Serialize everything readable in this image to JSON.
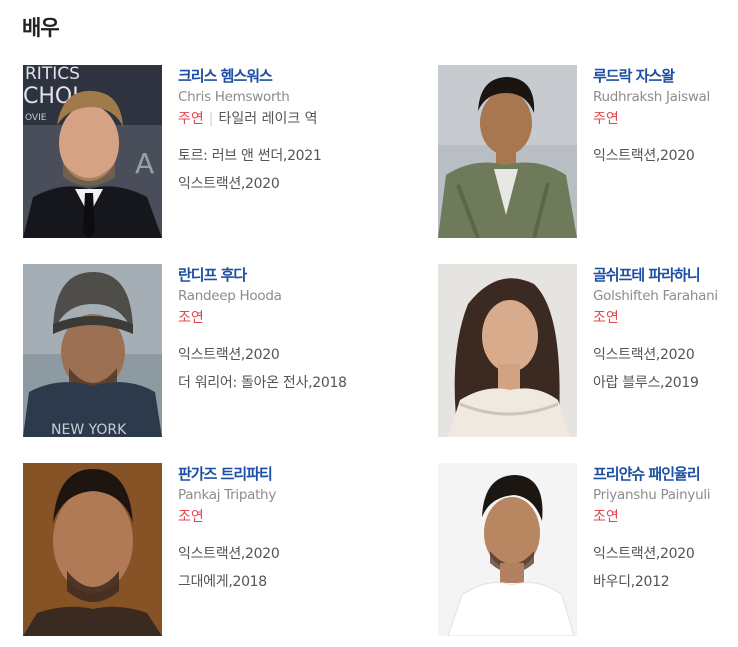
{
  "section": {
    "title": "배우"
  },
  "actors": [
    {
      "name_ko": "크리스 헴스워스",
      "name_en": "Chris Hemsworth",
      "role": "주연",
      "character": "타일러 레이크 역",
      "works": [
        "토르: 러브 앤 썬더,2021",
        "익스트랙션,2020"
      ]
    },
    {
      "name_ko": "루드락 자스왈",
      "name_en": "Rudhraksh Jaiswal",
      "role": "주연",
      "character": "",
      "works": [
        "익스트랙션,2020"
      ]
    },
    {
      "name_ko": "란디프 후다",
      "name_en": "Randeep Hooda",
      "role": "조연",
      "character": "",
      "works": [
        "익스트랙션,2020",
        "더 워리어: 돌아온 전사,2018"
      ]
    },
    {
      "name_ko": "골쉬프테 파라하니",
      "name_en": "Golshifteh Farahani",
      "role": "조연",
      "character": "",
      "works": [
        "익스트랙션,2020",
        "아랍 블루스,2019"
      ]
    },
    {
      "name_ko": "판가즈 트리파티",
      "name_en": "Pankaj Tripathy",
      "role": "조연",
      "character": "",
      "works": [
        "익스트랙션,2020",
        "그대에게,2018"
      ]
    },
    {
      "name_ko": "프리얀슈 패인율리",
      "name_en": "Priyanshu Painyuli",
      "role": "조연",
      "character": "",
      "works": [
        "익스트랙션,2020",
        "바우디,2012"
      ]
    }
  ],
  "photo_art": {
    "backdrop_text_1": "RITICS",
    "backdrop_text_2": "CHOI",
    "backdrop_text_3": "OVIE",
    "backdrop_text_4": "A",
    "hoodie_text": "NEW YORK"
  },
  "colors": {
    "name_link": "#1d4fa3",
    "role": "#e0474f",
    "secondary": "#8c8c8c",
    "body": "#555555"
  }
}
